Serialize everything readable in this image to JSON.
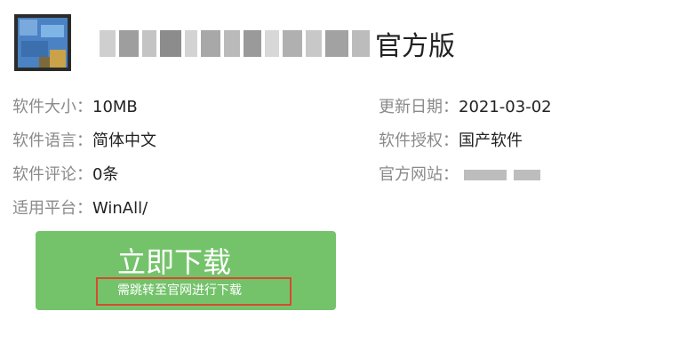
{
  "header": {
    "app_title_suffix": "官方版"
  },
  "info": {
    "size_label": "软件大小：",
    "size_value": "10MB",
    "update_label": "更新日期：",
    "update_value": "2021-03-02",
    "language_label": "软件语言：",
    "language_value": "简体中文",
    "license_label": "软件授权：",
    "license_value": "国产软件",
    "reviews_label": "软件评论：",
    "reviews_value": "0条",
    "website_label": "官方网站：",
    "platform_label": "适用平台：",
    "platform_value": "WinAll/"
  },
  "download": {
    "button_label": "立即下载",
    "note": "需跳转至官网进行下载",
    "button_color": "#74c36b",
    "highlight_color": "#d9492f"
  }
}
